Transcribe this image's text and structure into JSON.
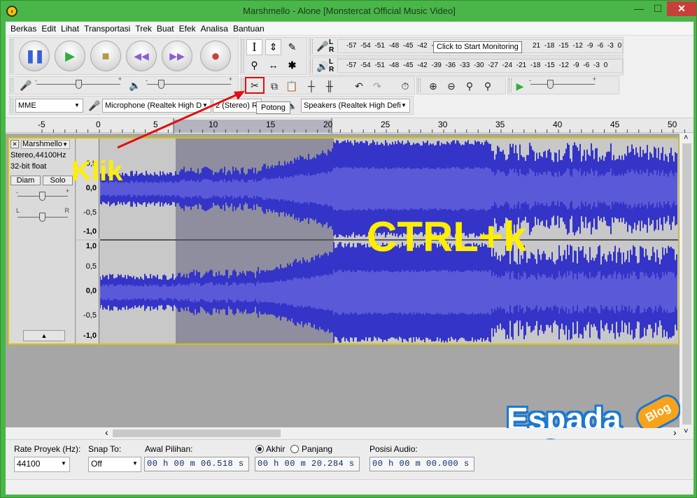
{
  "window": {
    "title": "Marshmello - Alone [Monstercat Official Music Video]",
    "minimize": "—",
    "maximize": "☐",
    "close": "✕"
  },
  "menu": [
    "Berkas",
    "Edit",
    "Lihat",
    "Transportasi",
    "Trek",
    "Buat",
    "Efek",
    "Analisa",
    "Bantuan"
  ],
  "transport": {
    "pause": "pause-icon",
    "play": "play-icon",
    "stop": "stop-icon",
    "skip_start": "skip-to-start-icon",
    "skip_end": "skip-to-end-icon",
    "record": "record-icon"
  },
  "tools": {
    "selection": "I",
    "envelope": "⇕",
    "draw": "✎",
    "zoom": "⚲",
    "timeshift": "↔",
    "multi": "✱"
  },
  "meters": {
    "record_scale": "-57 -54 -51 -48 -45 -42 -3",
    "record_scale_tail": "21 -18 -15 -12 -9 -6 -3 0",
    "play_scale": "-57 -54 -51 -48 -45 -42 -39 -36 -33 -30 -27 -24 -21 -18 -15 -12 -9 -6 -3 0",
    "L": "L",
    "R": "R"
  },
  "tooltips": {
    "monitor": "Click to Start Monitoring",
    "cut": "Potong"
  },
  "mixer": {
    "plus": "+",
    "minus": "-"
  },
  "device": {
    "host": "MME",
    "mic": "Microphone (Realtek High D",
    "channels": "2 (Stereo) R",
    "speakers": "Speakers (Realtek High Defi"
  },
  "ruler": [
    "-5",
    "0",
    "5",
    "10",
    "15",
    "20",
    "25",
    "30",
    "35",
    "40",
    "45",
    "50"
  ],
  "track": {
    "close": "✕",
    "name": "Marshmello",
    "rate": "Stereo,44100Hz",
    "format": "32-bit float",
    "mute": "Diam",
    "solo": "Solo",
    "pan_left": "L",
    "pan_right": "R",
    "collapse": "▲",
    "scale": [
      "1,0",
      "0,5",
      "0,0",
      "-0,5",
      "-1,0"
    ]
  },
  "scroll": {
    "left": "‹",
    "right": "›",
    "up": "˄",
    "down": "˅"
  },
  "selection_bar": {
    "rate_label": "Rate Proyek (Hz):",
    "rate_value": "44100",
    "snap_label": "Snap To:",
    "snap_value": "Off",
    "start_label": "Awal Pilihan:",
    "start_value": "00 h 00 m 06.518 s",
    "end_label": "Akhir",
    "length_label": "Panjang",
    "end_value": "00 h 00 m 20.284 s",
    "pos_label": "Posisi Audio:",
    "pos_value": "00 h 00 m 00.000 s"
  },
  "annotations": {
    "click_label": "Klik",
    "shortcut": "CTRL+k"
  },
  "brand": {
    "name": "Espada",
    "badge": "Blog"
  },
  "colors": {
    "wave": "#3434c8",
    "wave_sel": "#5a5ad8",
    "selection_bg": "#8e8e9e",
    "track_border": "#d6c500",
    "annotation": "#ffee00",
    "arrow": "#e01010",
    "window": "#4ab649"
  }
}
